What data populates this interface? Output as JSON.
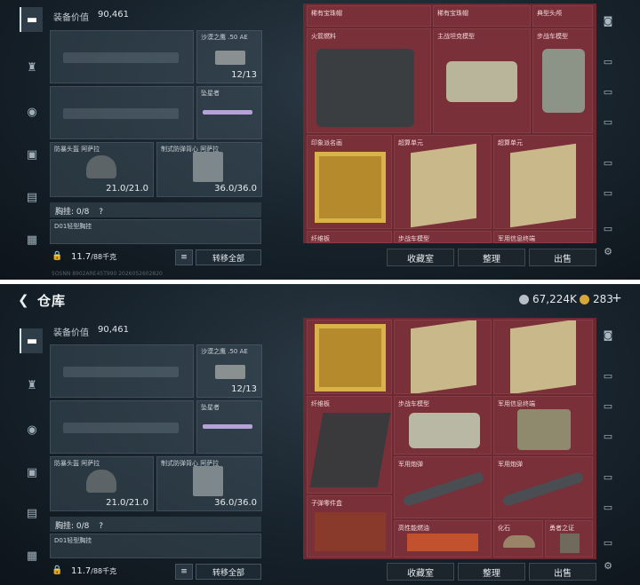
{
  "screens": [
    {
      "equip_label": "装备价值",
      "equip_value": "90,461",
      "slots": {
        "sidearm_name": "沙漠之鹰 .50 AE",
        "sidearm_ammo": "12/13",
        "melee_name": "坠星者",
        "helmet_name": "防暴头盔 阿萨拉",
        "helmet_dur": "21.0/21.0",
        "armor_name": "制式防弹背心 阿萨拉",
        "armor_dur": "36.0/36.0"
      },
      "chest_label": "胸挂: 0/8",
      "chest_q": "?",
      "chest_item": "D01轻型胸挂",
      "weight": "11.7",
      "weight_unit": "/88千克",
      "transfer_all": "转移全部",
      "watermark": "5OSNN 8902ARE45T990 2026052602820",
      "stash_cells": [
        "稀有宝珠帽",
        "稀有宝珠帽",
        "典型头颅",
        "火箭燃料",
        "主战坦克模型",
        "步战车模型",
        "印象派名画",
        "超算单元",
        "超算单元",
        "纤维板",
        "步战车模型",
        "军用信息终端"
      ],
      "actions": {
        "collection": "收藏室",
        "organize": "整理",
        "sell": "出售"
      }
    },
    {
      "back_icon": "back-arrow-icon",
      "title": "仓库",
      "currency1": "67,224K",
      "currency2": "283",
      "plus": "+",
      "equip_label": "装备价值",
      "equip_value": "90,461",
      "slots": {
        "sidearm_name": "沙漠之鹰 .50 AE",
        "sidearm_ammo": "12/13",
        "melee_name": "坠星者",
        "helmet_name": "防暴头盔 阿萨拉",
        "helmet_dur": "21.0/21.0",
        "armor_name": "制式防弹背心 阿萨拉",
        "armor_dur": "36.0/36.0"
      },
      "chest_label": "胸挂: 0/8",
      "chest_q": "?",
      "chest_item": "D01轻型胸挂",
      "weight": "11.7",
      "weight_unit": "/88千克",
      "transfer_all": "转移全部",
      "stash_cells": [
        "纤维板",
        "步战车模型",
        "军用信息终端",
        "军用炮弹",
        "军用炮弹",
        "子弹零件盒",
        "高性能燃油",
        "化石",
        "勇者之证"
      ],
      "actions": {
        "collection": "收藏室",
        "organize": "整理",
        "sell": "出售"
      }
    }
  ],
  "colors": {
    "stash_bg": "#6a2a31",
    "cell_bg": "#7a3038",
    "panel_bg": "#17222b"
  }
}
